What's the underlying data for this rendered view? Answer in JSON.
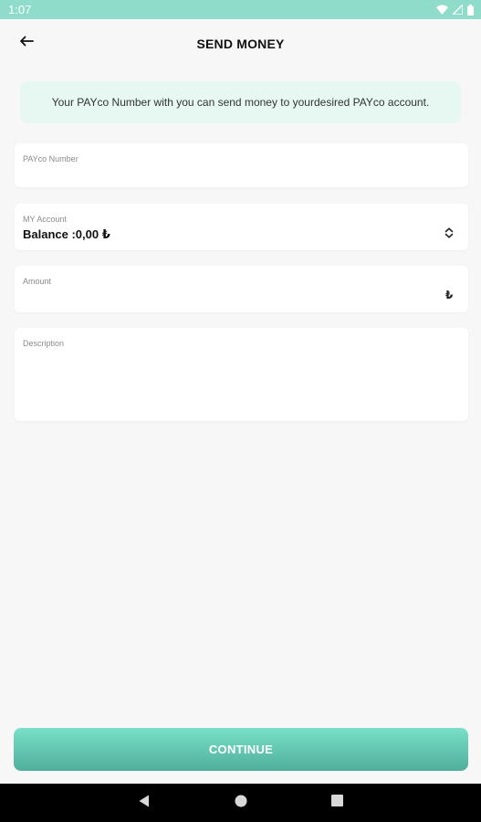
{
  "status_bar": {
    "time": "1:07",
    "icons": [
      "wifi-icon",
      "signal-icon",
      "battery-icon"
    ]
  },
  "header": {
    "title": "SEND MONEY",
    "back_icon": "arrow-left-icon"
  },
  "info": {
    "text": "Your PAYco Number with you can send money to yourdesired PAYco account."
  },
  "form": {
    "payco_number": {
      "label": "PAYco Number",
      "value": ""
    },
    "account": {
      "label": "MY Account",
      "value": "Balance :0,00 ₺",
      "icon": "swap-vertical-icon"
    },
    "amount": {
      "label": "Amount",
      "value": "",
      "currency_symbol": "₺"
    },
    "description": {
      "label": "Description",
      "value": ""
    }
  },
  "continue_button": {
    "label": "CONTINUE"
  },
  "nav": {
    "icons": [
      "back-triangle-icon",
      "home-circle-icon",
      "recents-square-icon"
    ]
  },
  "colors": {
    "status_bar": "#8fdccb",
    "accent": "#5dc3ad",
    "banner_bg": "#e7f8f3",
    "background": "#f7f7f7"
  }
}
